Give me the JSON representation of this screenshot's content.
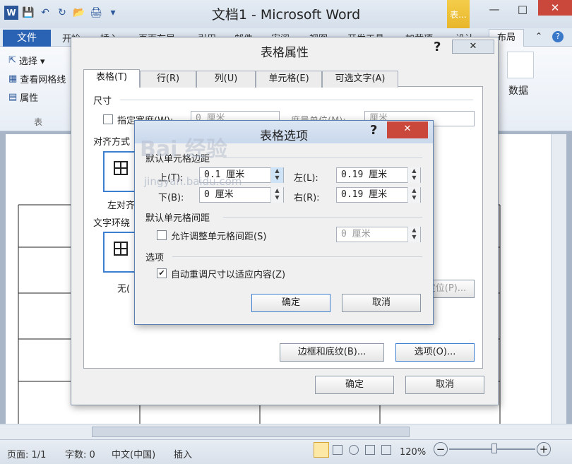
{
  "window": {
    "title": "文档1 - Microsoft Word",
    "context_tab": "表...",
    "minimize": "—",
    "maximize": "□",
    "close": "✕"
  },
  "qat": {
    "word_logo": "W",
    "save": "💾",
    "undo": "↶",
    "redo": "↻",
    "open": "📂",
    "print": "🖨",
    "more": "▾"
  },
  "ribbon": {
    "file_tab": "文件",
    "tabs": [
      "开始",
      "插入",
      "页面布局",
      "引用",
      "邮件",
      "审阅",
      "视图",
      "开发工具",
      "加载项",
      "设计"
    ],
    "active_tab": "布局",
    "select": "选择 ▾",
    "view_gridlines": "查看网格线",
    "properties": "属性",
    "group_table": "表",
    "data": "数据",
    "help": "?"
  },
  "table_props": {
    "title": "表格属性",
    "help": "?",
    "close": "✕",
    "tabs": [
      "表格(T)",
      "行(R)",
      "列(U)",
      "单元格(E)",
      "可选文字(A)"
    ],
    "size_label": "尺寸",
    "specify_width": "指定宽度(W):",
    "width_value": "0 厘米",
    "measure_label": "度量单位(M):",
    "measure_value": "厘米",
    "align_label": "对齐方式",
    "align_left": "左对齐",
    "wrap_label": "文字环绕",
    "wrap_none": "无(",
    "positioning": "定位(P)...",
    "border_btn": "边框和底纹(B)...",
    "options_btn": "选项(O)...",
    "ok": "确定",
    "cancel": "取消"
  },
  "table_options": {
    "title": "表格选项",
    "help": "?",
    "close": "✕",
    "margins_label": "默认单元格边距",
    "top_label": "上(T):",
    "top_value": "0.1 厘米",
    "bottom_label": "下(B):",
    "bottom_value": "0 厘米",
    "left_label": "左(L):",
    "left_value": "0.19 厘米",
    "right_label": "右(R):",
    "right_value": "0.19 厘米",
    "spacing_label": "默认单元格间距",
    "allow_spacing": "允许调整单元格间距(S)",
    "spacing_value": "0 厘米",
    "options_label": "选项",
    "autofit": "自动重调尺寸以适应内容(Z)",
    "ok": "确定",
    "cancel": "取消"
  },
  "watermark": {
    "brand": "Bai 经验",
    "url": "jingyan.baidu.com"
  },
  "status": {
    "page": "页面: 1/1",
    "words": "字数: 0",
    "lang": "中文(中国)",
    "mode": "插入",
    "zoom": "120%",
    "zoom_out": "−",
    "zoom_in": "+"
  }
}
